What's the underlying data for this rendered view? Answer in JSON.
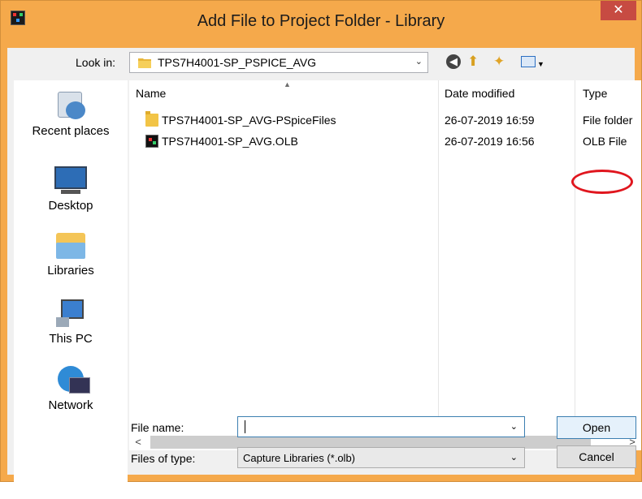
{
  "window": {
    "title": "Add File to Project Folder - Library",
    "close_glyph": "✕",
    "accent_color": "#f5a94b",
    "app_icon": "capture-app-icon"
  },
  "toolbar": {
    "look_in_label": "Look in:",
    "look_in_value": "TPS7H4001-SP_PSPICE_AVG",
    "dropdown_glyph": "⌄",
    "icons": [
      "back-icon",
      "up-folder-icon",
      "new-folder-icon",
      "view-menu-icon"
    ]
  },
  "places": [
    {
      "label": "Recent places",
      "icon": "recent-places-icon"
    },
    {
      "label": "Desktop",
      "icon": "desktop-icon"
    },
    {
      "label": "Libraries",
      "icon": "libraries-icon"
    },
    {
      "label": "This PC",
      "icon": "this-pc-icon"
    },
    {
      "label": "Network",
      "icon": "network-icon"
    }
  ],
  "columns": {
    "name": "Name",
    "date": "Date modified",
    "type": "Type"
  },
  "files": [
    {
      "name": "TPS7H4001-SP_AVG-PSpiceFiles",
      "date": "26-07-2019 16:59",
      "type": "File folder",
      "icon": "folder-icon"
    },
    {
      "name": "TPS7H4001-SP_AVG.OLB",
      "date": "26-07-2019 16:56",
      "type": "OLB File",
      "icon": "olb-file-icon"
    }
  ],
  "scroll": {
    "left": "<",
    "right": ">"
  },
  "form": {
    "file_name_label": "File name:",
    "file_name_value": "",
    "files_of_type_label": "Files of type:",
    "files_of_type_value": "Capture Libraries (*.olb)",
    "open_label": "Open",
    "cancel_label": "Cancel"
  }
}
